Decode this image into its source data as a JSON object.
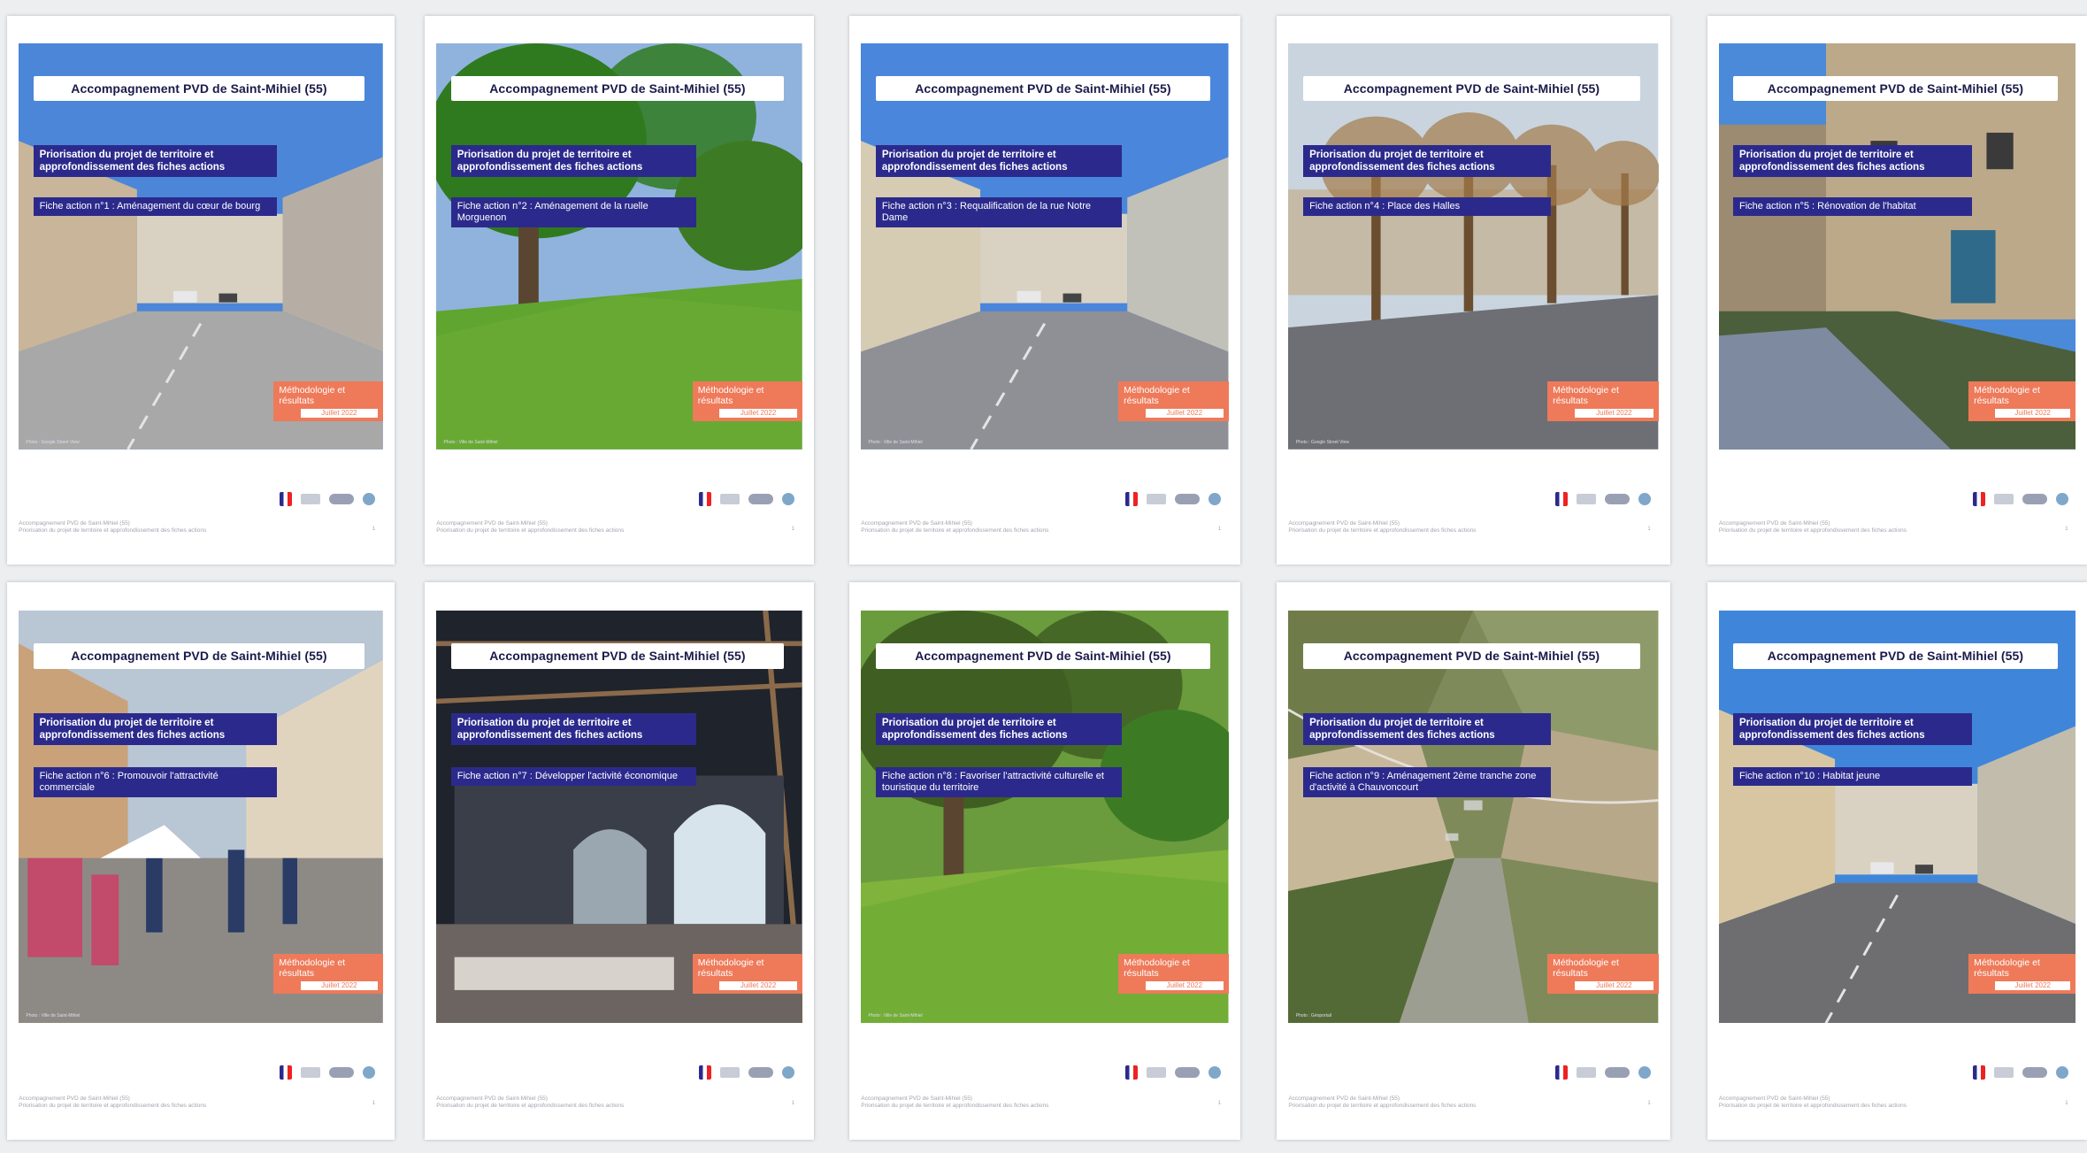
{
  "common": {
    "title": "Accompagnement PVD de Saint-Mihiel (55)",
    "subtitle": "Priorisation du projet de territoire et approfondissement des fiches actions",
    "method_label": "Méthodologie et résultats",
    "date_label": "Juillet 2022",
    "footer_line1": "Accompagnement PVD de Saint-Mihiel (55)",
    "footer_line2": "Priorisation du projet de territoire et approfondissement des fiches actions",
    "page_number": "1"
  },
  "sheets": [
    {
      "fiche": "Fiche action n°1 : Aménagement du cœur de bourg",
      "credit": "Photo : Google Street View",
      "scene": "street",
      "colors": {
        "sky": "#4b86d9",
        "ground": "#a8a8a8",
        "accent": "#c9b59a"
      }
    },
    {
      "fiche": "Fiche action n°2 : Aménagement de la ruelle Morguenon",
      "credit": "Photo : Ville de Saint-Mihiel",
      "scene": "green",
      "colors": {
        "sky": "#8fb3dc",
        "ground": "#5fa530",
        "accent": "#2f7a1f"
      }
    },
    {
      "fiche": "Fiche action n°3 : Requalification de la rue Notre Dame",
      "credit": "Photo : Ville de Saint-Mihiel",
      "scene": "road",
      "colors": {
        "sky": "#4a86dc",
        "ground": "#8e9096",
        "accent": "#d6cbb3"
      }
    },
    {
      "fiche": "Fiche action n°4 : Place des Halles",
      "credit": "Photo : Google Street View",
      "scene": "square",
      "colors": {
        "sky": "#c9d4de",
        "ground": "#6d6f74",
        "accent": "#a89a74"
      }
    },
    {
      "fiche": "Fiche action n°5 : Rénovation de l'habitat",
      "credit": "",
      "scene": "canal",
      "colors": {
        "sky": "#4b8ad8",
        "ground": "#4c5f3c",
        "accent": "#bca98a"
      }
    },
    {
      "fiche": "Fiche action n°6 : Promouvoir l'attractivité commerciale",
      "credit": "Photo : Ville de Saint-Mihiel",
      "scene": "market",
      "colors": {
        "sky": "#b9c6d4",
        "ground": "#8d8a86",
        "accent": "#c24a6a"
      }
    },
    {
      "fiche": "Fiche action n°7 : Développer l'activité économique",
      "credit": "",
      "scene": "hall",
      "colors": {
        "sky": "#1f232b",
        "ground": "#6b6460",
        "accent": "#d7d3cc"
      }
    },
    {
      "fiche": "Fiche action n°8 : Favoriser l'attractivité culturelle et touristique du territoire",
      "credit": "Photo : Ville de Saint-Mihiel",
      "scene": "forest",
      "colors": {
        "sky": "#6a9b3d",
        "ground": "#7fb33b",
        "accent": "#3f5f22"
      }
    },
    {
      "fiche": "Fiche action n°9 : Aménagement 2ème tranche zone d'activité à Chauvoncourt",
      "credit": "Photo : Géoportail",
      "scene": "aerial",
      "colors": {
        "sky": "#9a9a80",
        "ground": "#7f8a5a",
        "accent": "#c8b89a"
      }
    },
    {
      "fiche": "Fiche action n°10 : Habitat jeune",
      "credit": "",
      "scene": "plaza",
      "colors": {
        "sky": "#3f86db",
        "ground": "#6e6e70",
        "accent": "#d8c6a2"
      }
    }
  ]
}
